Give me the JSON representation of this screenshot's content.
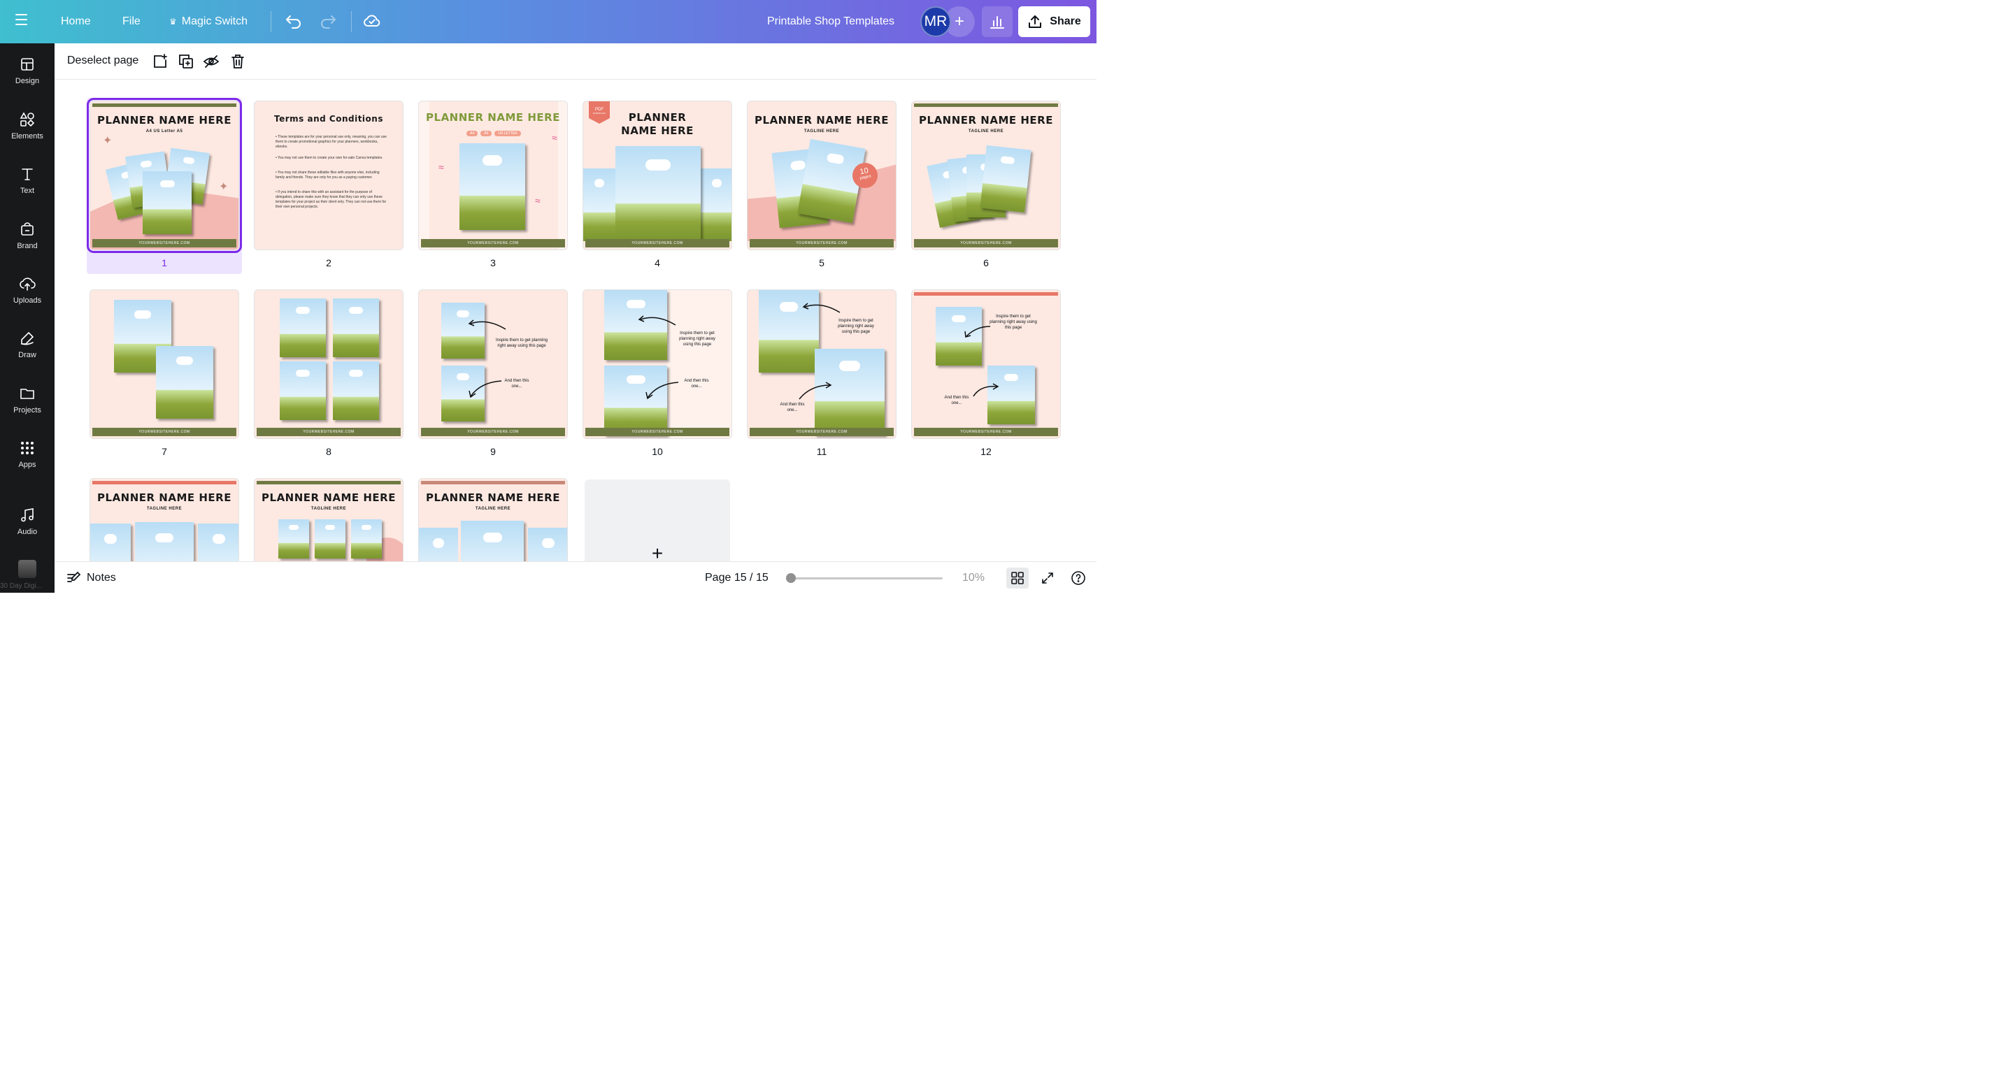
{
  "topbar": {
    "home": "Home",
    "file": "File",
    "magic_switch": "Magic Switch",
    "doc_title": "Printable Shop Templates",
    "avatar_initials": "MR",
    "add_collab": "+",
    "share": "Share"
  },
  "sidebar": {
    "items": [
      {
        "label": "Design"
      },
      {
        "label": "Elements"
      },
      {
        "label": "Text"
      },
      {
        "label": "Brand"
      },
      {
        "label": "Uploads"
      },
      {
        "label": "Draw"
      },
      {
        "label": "Projects"
      },
      {
        "label": "Apps"
      },
      {
        "label": "Audio"
      }
    ],
    "bottom_label": "30 Day Digi..."
  },
  "pagebar": {
    "deselect": "Deselect page"
  },
  "pages": {
    "footer_text": "YOURWEBSITEHERE.COM",
    "planner_title": "PLANNER NAME HERE",
    "planner_title_l1": "PLANNER",
    "planner_title_l2": "NAME HERE",
    "tagline": "TAGLINE HERE",
    "sizes": "A4   US Letter   A5",
    "size_a4": "A4",
    "size_a5": "A5",
    "size_usletter": "US LETTER",
    "pdf_badge": "PDF",
    "pdf_sub": "DOWNLOAD",
    "ten_pages_num": "10",
    "ten_pages_word": "pages",
    "terms_title": "Terms and Conditions",
    "terms_1": "• These templates are for your personal use only, meaning, you can use them to create promotional graphics for your planners, workbooks, ebooks.",
    "terms_2": "• You may not use them to create your own for-sale Canva templates.",
    "terms_3": "• You may not share these editable files with anyone else, including family and friends. They are only for you as a paying customer.",
    "terms_4": "• If you intend to share this with an assistant for the purpose of delegation, please make sure they know that they can only use these templates for your project as their client only. They can not use them for their own personal projects.",
    "inspire": "Inspire them to get planning right away using this page",
    "and_then": "And then this one...",
    "numbers": [
      "1",
      "2",
      "3",
      "4",
      "5",
      "6",
      "7",
      "8",
      "9",
      "10",
      "11",
      "12"
    ]
  },
  "add_page": "+",
  "bottombar": {
    "notes": "Notes",
    "page_count": "Page 15 / 15",
    "zoom": "10%"
  },
  "colors": {
    "accent": "#7d2ae8",
    "olive": "#6f7a43",
    "page_bg": "#fde9e2",
    "avatar": "#1c3aa9"
  }
}
